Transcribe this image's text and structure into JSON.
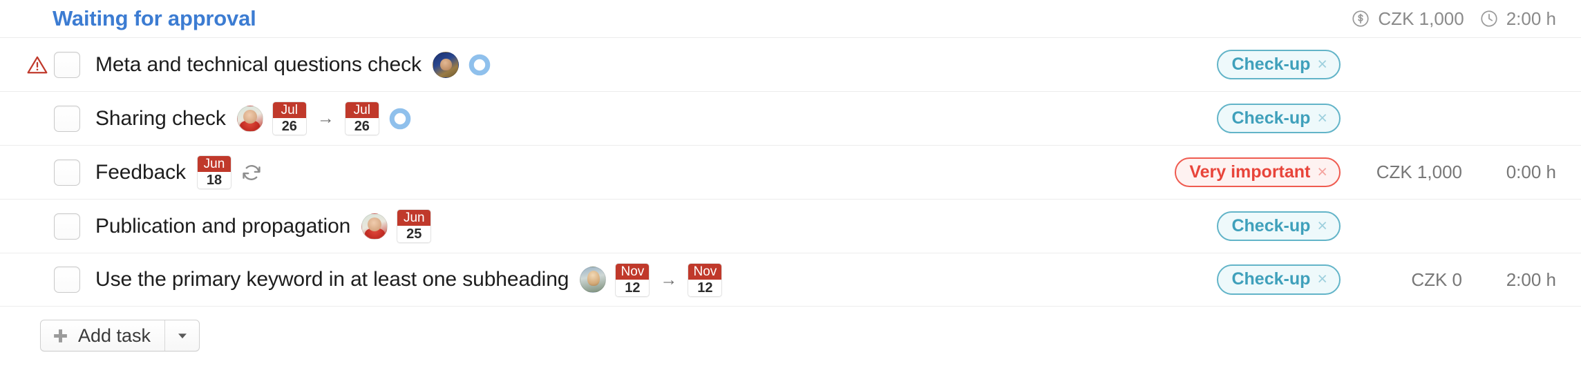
{
  "section": {
    "title": "Waiting for approval",
    "stats": {
      "money_icon": "dollar-circle-icon",
      "money": "CZK 1,000",
      "time_icon": "clock-icon",
      "time": "2:00 h"
    }
  },
  "tasks": [
    {
      "warning_icon": "warning-triangle-icon",
      "has_warning": true,
      "title": "Meta and technical questions check",
      "avatars": [
        "avatar-dark-blue"
      ],
      "dates": [],
      "progress_ring": true,
      "repeat": false,
      "tag": {
        "label": "Check-up",
        "type": "checkup",
        "close": "×"
      },
      "money": "",
      "time": ""
    },
    {
      "warning_icon": "",
      "has_warning": false,
      "title": "Sharing check",
      "avatars": [
        "avatar-red-scarf"
      ],
      "dates": [
        {
          "month": "Jul",
          "day": "26"
        },
        {
          "month": "Jul",
          "day": "26"
        }
      ],
      "progress_ring": true,
      "repeat": false,
      "tag": {
        "label": "Check-up",
        "type": "checkup",
        "close": "×"
      },
      "money": "",
      "time": ""
    },
    {
      "warning_icon": "",
      "has_warning": false,
      "title": "Feedback",
      "avatars": [],
      "dates": [
        {
          "month": "Jun",
          "day": "18"
        }
      ],
      "progress_ring": false,
      "repeat": true,
      "tag": {
        "label": "Very important",
        "type": "important",
        "close": "×"
      },
      "money": "CZK 1,000",
      "time": "0:00 h"
    },
    {
      "warning_icon": "",
      "has_warning": false,
      "title": "Publication and propagation",
      "avatars": [
        "avatar-red-scarf"
      ],
      "dates": [
        {
          "month": "Jun",
          "day": "25"
        }
      ],
      "progress_ring": false,
      "repeat": false,
      "tag": {
        "label": "Check-up",
        "type": "checkup",
        "close": "×"
      },
      "money": "",
      "time": ""
    },
    {
      "warning_icon": "",
      "has_warning": false,
      "title": "Use the primary keyword in at least one subheading",
      "avatars": [
        "avatar-outdoor"
      ],
      "dates": [
        {
          "month": "Nov",
          "day": "12"
        },
        {
          "month": "Nov",
          "day": "12"
        }
      ],
      "progress_ring": false,
      "repeat": false,
      "tag": {
        "label": "Check-up",
        "type": "checkup",
        "close": "×"
      },
      "money": "CZK 0",
      "time": "2:00 h"
    }
  ],
  "footer": {
    "add_task_label": "Add task",
    "plus_icon": "plus-icon",
    "caret_icon": "chevron-down-icon"
  },
  "colors": {
    "section_title": "#3c7cd2",
    "tag_checkup": "#3fa0bb",
    "tag_important": "#e8443a",
    "date_badge_header": "#c0392b",
    "warning": "#c0392b",
    "progress_ring": "#8fc0ec",
    "muted_text": "#8a8a8a"
  }
}
